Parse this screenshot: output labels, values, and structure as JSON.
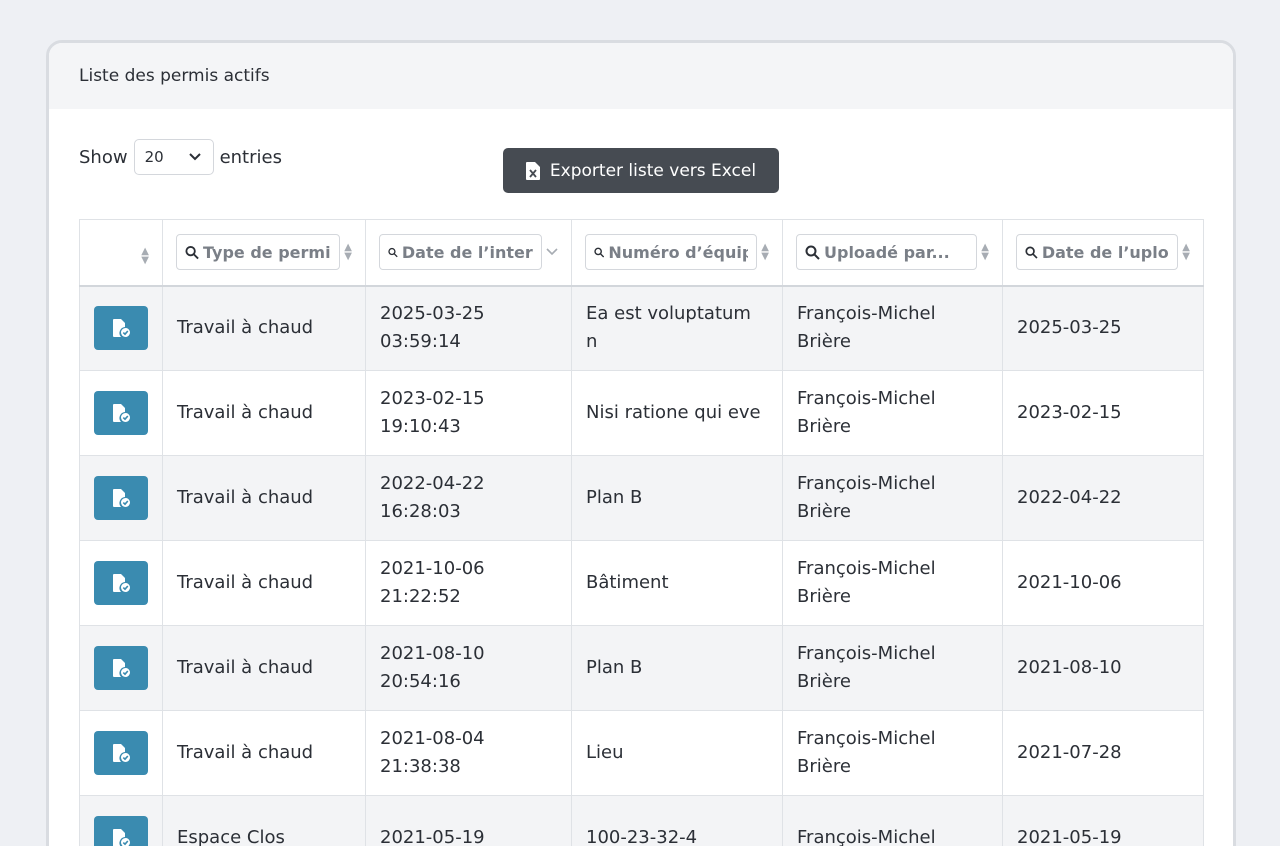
{
  "card": {
    "title": "Liste des permis actifs"
  },
  "length_control": {
    "show_label": "Show",
    "value": "20",
    "entries_label": "entries"
  },
  "export_button": {
    "label": "Exporter liste vers Excel"
  },
  "table": {
    "filters": [
      "Type de permis",
      "Date de l’intervention",
      "Numéro d’équipement",
      "Uploadé par...",
      "Date de l’upload"
    ],
    "rows": [
      {
        "type": "Travail à chaud",
        "date": "2025-03-25 03:59:14",
        "numero": "Ea est voluptatum n",
        "uploader": "François-Michel Brière",
        "upload_date": "2025-03-25"
      },
      {
        "type": "Travail à chaud",
        "date": "2023-02-15 19:10:43",
        "numero": "Nisi ratione qui eve",
        "uploader": "François-Michel Brière",
        "upload_date": "2023-02-15"
      },
      {
        "type": "Travail à chaud",
        "date": "2022-04-22 16:28:03",
        "numero": "Plan B",
        "uploader": "François-Michel Brière",
        "upload_date": "2022-04-22"
      },
      {
        "type": "Travail à chaud",
        "date": "2021-10-06 21:22:52",
        "numero": "Bâtiment",
        "uploader": "François-Michel Brière",
        "upload_date": "2021-10-06"
      },
      {
        "type": "Travail à chaud",
        "date": "2021-08-10 20:54:16",
        "numero": "Plan B",
        "uploader": "François-Michel Brière",
        "upload_date": "2021-08-10"
      },
      {
        "type": "Travail à chaud",
        "date": "2021-08-04 21:38:38",
        "numero": "Lieu",
        "uploader": "François-Michel Brière",
        "upload_date": "2021-07-28"
      },
      {
        "type": "Espace Clos",
        "date": "2021-05-19",
        "numero": "100-23-32-4",
        "uploader": "François-Michel",
        "upload_date": "2021-05-19"
      }
    ]
  },
  "colors": {
    "action_button": "#3a8bb0",
    "export_button": "#464b52",
    "stripe": "#f3f4f6"
  },
  "icons": {
    "filter": "search-icon",
    "action": "file-check-icon",
    "export": "excel-file-icon",
    "sort": "sort-icon",
    "dropdown": "chevron-down-icon"
  }
}
